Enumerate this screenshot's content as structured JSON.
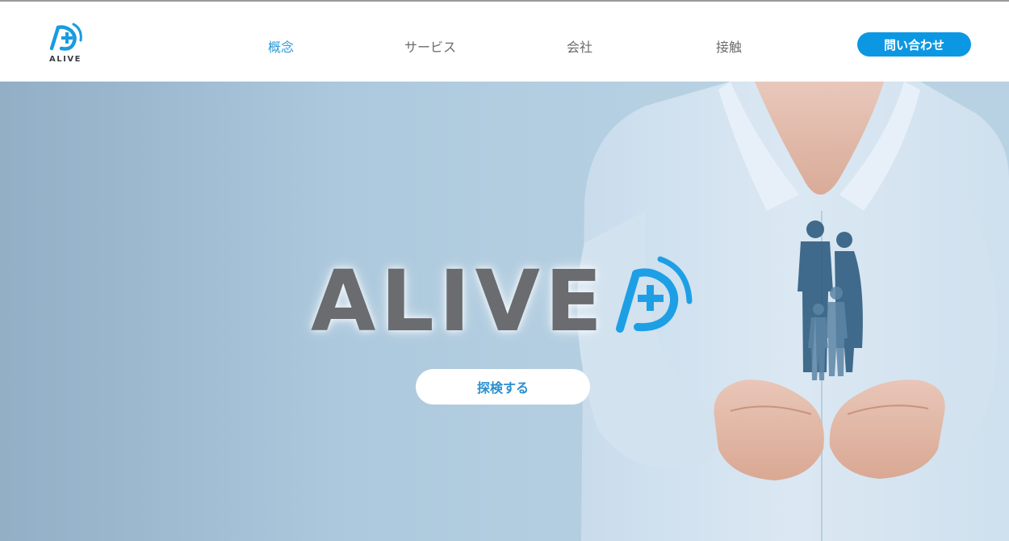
{
  "header": {
    "logo_text": "ALIVE",
    "nav": [
      {
        "label": "概念",
        "active": true
      },
      {
        "label": "サービス",
        "active": false
      },
      {
        "label": "会社",
        "active": false
      },
      {
        "label": "接触",
        "active": false
      }
    ],
    "contact_label": "問い合わせ"
  },
  "hero": {
    "brand_text": "ALIVE",
    "explore_label": "探検する"
  },
  "colors": {
    "accent": "#0c97e3",
    "nav_active": "#2c9ad6",
    "nav_text": "#6b6b6b",
    "brand_gray": "#6a6c70",
    "hero_bg": "#b2cde0"
  },
  "icons": {
    "logo": "alive-plus-logo-icon",
    "brand_mark": "alive-plus-mark-icon"
  }
}
